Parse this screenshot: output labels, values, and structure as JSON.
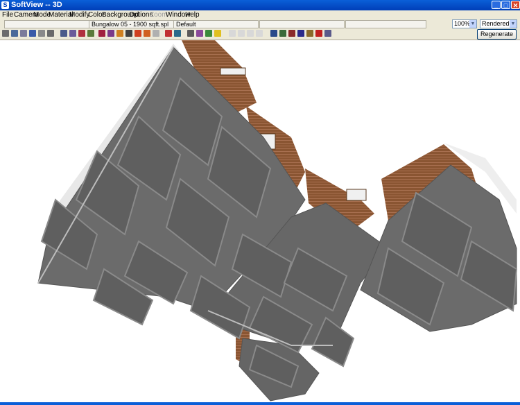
{
  "window": {
    "title": "SoftView -- 3D",
    "minimize": "_",
    "maximize": "□",
    "close": "✕"
  },
  "menu": {
    "items": [
      "File",
      "Camera",
      "Mode",
      "Material",
      "Modify",
      "Color",
      "Background",
      "Options",
      "Zoom",
      "Window",
      "Help"
    ]
  },
  "status": {
    "file": "Bungalow 05 - 1900 sqft.spl",
    "style": "Default"
  },
  "controls": {
    "zoom": "100%",
    "render_mode": "Rendered",
    "regenerate_label": "Regenerate"
  },
  "colors": {
    "titlebar": "#0a5fd8",
    "panel": "#ece9d8",
    "roof": "#6b6b6b",
    "brick": "#8a5532"
  },
  "icons": [
    "new-icon",
    "print-icon",
    "save-icon",
    "open-icon",
    "layer-icon",
    "grid-icon",
    "zoom-in-icon",
    "zoom-out-icon",
    "zoom-window-icon",
    "zoom-extents-icon",
    "pan-icon",
    "orbit-icon",
    "undo-icon",
    "redo-icon",
    "edit-icon",
    "material-icon",
    "image-icon",
    "camera-icon",
    "walk-icon",
    "fit-icon",
    "sun-icon",
    "view-front-icon",
    "view-back-icon",
    "view-side-icon",
    "view-top-icon",
    "pencil-icon",
    "pencil-icon",
    "pencil-icon",
    "pencil-icon",
    "brush-icon",
    "refresh-icon",
    "zoom-icon"
  ]
}
